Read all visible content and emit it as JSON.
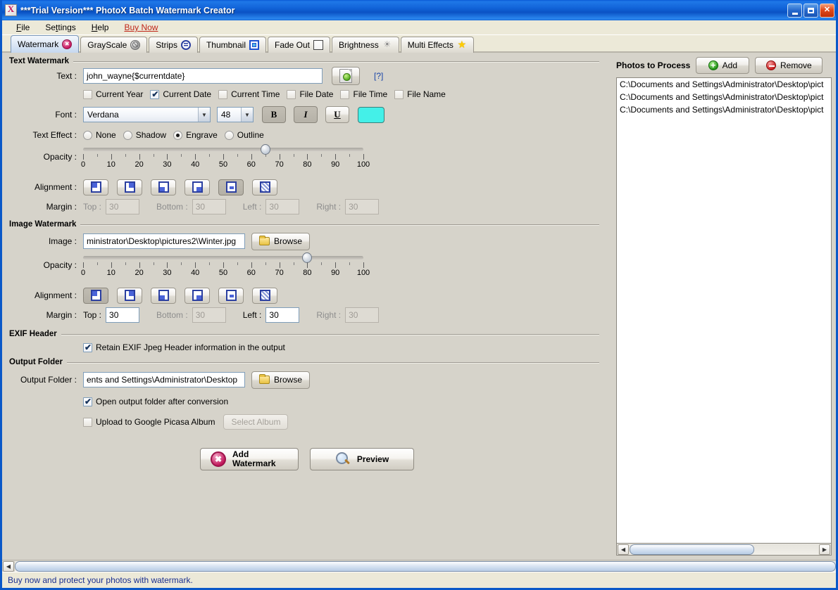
{
  "window": {
    "title": "***Trial Version*** PhotoX Batch Watermark Creator",
    "app_icon": "photox-icon",
    "minimize_label": "Minimize",
    "maximize_label": "Maximize",
    "close_label": "Close"
  },
  "menu": {
    "items": [
      {
        "label": "File"
      },
      {
        "label": "Settings"
      },
      {
        "label": "Help"
      },
      {
        "label": "Buy Now"
      }
    ]
  },
  "tabs": [
    {
      "label": "Watermark",
      "icon": "sad-face-icon",
      "active": true
    },
    {
      "label": "GrayScale",
      "icon": "grayscale-icon",
      "active": false
    },
    {
      "label": "Strips",
      "icon": "strips-icon",
      "active": false
    },
    {
      "label": "Thumbnail",
      "icon": "thumbnail-icon",
      "active": false
    },
    {
      "label": "Fade Out",
      "icon": "fade-out-icon",
      "active": false
    },
    {
      "label": "Brightness",
      "icon": "brightness-icon",
      "active": false
    },
    {
      "label": "Multi Effects",
      "icon": "star-icon",
      "active": false
    }
  ],
  "text_watermark": {
    "section_title": "Text Watermark",
    "text_label": "Text :",
    "text_value": "john_wayne{$currentdate}",
    "text_file_button_icon": "text-file-icon",
    "help_link": "[?]",
    "token_checkboxes": [
      {
        "label": "Current Year",
        "checked": false
      },
      {
        "label": "Current Date",
        "checked": true
      },
      {
        "label": "Current Time",
        "checked": false
      },
      {
        "label": "File Date",
        "checked": false
      },
      {
        "label": "File Time",
        "checked": false
      },
      {
        "label": "File Name",
        "checked": false
      }
    ],
    "font_label": "Font :",
    "font_value": "Verdana",
    "font_size_value": "48",
    "bold_label": "B",
    "italic_label": "I",
    "underline_label": "U",
    "bold_pressed": true,
    "italic_pressed": true,
    "underline_pressed": false,
    "color_swatch": "#44f0e8",
    "text_effect_label": "Text Effect :",
    "text_effects": [
      {
        "label": "None",
        "selected": false
      },
      {
        "label": "Shadow",
        "selected": false
      },
      {
        "label": "Engrave",
        "selected": true
      },
      {
        "label": "Outline",
        "selected": false
      }
    ],
    "opacity_label": "Opacity :",
    "opacity_value": 65,
    "opacity_ticks": [
      "0",
      "10",
      "20",
      "30",
      "40",
      "50",
      "60",
      "70",
      "80",
      "90",
      "100"
    ],
    "alignment_label": "Alignment :",
    "alignments": [
      {
        "name": "top-left",
        "selected": false
      },
      {
        "name": "top-right",
        "selected": false
      },
      {
        "name": "bottom-left",
        "selected": false
      },
      {
        "name": "bottom-right",
        "selected": false
      },
      {
        "name": "center",
        "selected": true
      },
      {
        "name": "tile",
        "selected": false
      }
    ],
    "margin_label": "Margin :",
    "margins": [
      {
        "label": "Top :",
        "value": "30",
        "enabled": false
      },
      {
        "label": "Bottom :",
        "value": "30",
        "enabled": false
      },
      {
        "label": "Left :",
        "value": "30",
        "enabled": false
      },
      {
        "label": "Right :",
        "value": "30",
        "enabled": false
      }
    ]
  },
  "image_watermark": {
    "section_title": "Image Watermark",
    "image_label": "Image :",
    "image_value": "ministrator\\Desktop\\pictures2\\Winter.jpg",
    "browse_label": "Browse",
    "opacity_label": "Opacity :",
    "opacity_value": 80,
    "opacity_ticks": [
      "0",
      "10",
      "20",
      "30",
      "40",
      "50",
      "60",
      "70",
      "80",
      "90",
      "100"
    ],
    "alignment_label": "Alignment :",
    "alignments": [
      {
        "name": "top-left",
        "selected": true
      },
      {
        "name": "top-right",
        "selected": false
      },
      {
        "name": "bottom-left",
        "selected": false
      },
      {
        "name": "bottom-right",
        "selected": false
      },
      {
        "name": "center",
        "selected": false
      },
      {
        "name": "tile",
        "selected": false
      }
    ],
    "margin_label": "Margin :",
    "margins": [
      {
        "label": "Top :",
        "value": "30",
        "enabled": true
      },
      {
        "label": "Bottom :",
        "value": "30",
        "enabled": false
      },
      {
        "label": "Left :",
        "value": "30",
        "enabled": true
      },
      {
        "label": "Right :",
        "value": "30",
        "enabled": false
      }
    ]
  },
  "exif": {
    "section_title": "EXIF Header",
    "retain_label": "Retain EXIF Jpeg Header information in the output",
    "retain_checked": true
  },
  "output": {
    "section_title": "Output Folder",
    "folder_label": "Output Folder :",
    "folder_value": "ents and Settings\\Administrator\\Desktop",
    "browse_label": "Browse",
    "open_after_label": "Open output folder after conversion",
    "open_after_checked": true,
    "picasa_label": "Upload to Google Picasa Album",
    "picasa_checked": false,
    "select_album_label": "Select Album",
    "select_album_enabled": false
  },
  "actions": {
    "add_watermark_line1": "Add",
    "add_watermark_line2": "Watermark",
    "preview_label": "Preview"
  },
  "photos": {
    "title": "Photos to Process",
    "add_label": "Add",
    "remove_label": "Remove",
    "items": [
      "C:\\Documents and Settings\\Administrator\\Desktop\\pict",
      "C:\\Documents and Settings\\Administrator\\Desktop\\pict",
      "C:\\Documents and Settings\\Administrator\\Desktop\\pict"
    ]
  },
  "statusbar": {
    "message": "Buy now and protect your photos with watermark."
  }
}
